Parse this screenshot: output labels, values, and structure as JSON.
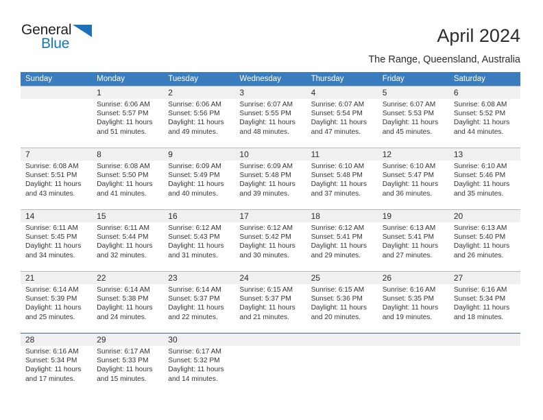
{
  "brand": {
    "name_top": "General",
    "name_bottom": "Blue",
    "color_top": "#231f20",
    "color_bottom": "#1277bc",
    "triangle_color": "#1f70b8"
  },
  "header": {
    "title": "April 2024",
    "subtitle": "The Range, Queensland, Australia"
  },
  "theme": {
    "header_bg": "#3a7dbf",
    "header_text": "#ffffff",
    "daynum_band": "#f0f0f0",
    "row_separator": "#b8b8b8",
    "last_row_separator": "#2e6da4"
  },
  "weekdays": [
    "Sunday",
    "Monday",
    "Tuesday",
    "Wednesday",
    "Thursday",
    "Friday",
    "Saturday"
  ],
  "weeks": [
    [
      {
        "day": "",
        "sunrise": "",
        "sunset": "",
        "daylight": ""
      },
      {
        "day": "1",
        "sunrise": "Sunrise: 6:06 AM",
        "sunset": "Sunset: 5:57 PM",
        "daylight": "Daylight: 11 hours and 51 minutes."
      },
      {
        "day": "2",
        "sunrise": "Sunrise: 6:06 AM",
        "sunset": "Sunset: 5:56 PM",
        "daylight": "Daylight: 11 hours and 49 minutes."
      },
      {
        "day": "3",
        "sunrise": "Sunrise: 6:07 AM",
        "sunset": "Sunset: 5:55 PM",
        "daylight": "Daylight: 11 hours and 48 minutes."
      },
      {
        "day": "4",
        "sunrise": "Sunrise: 6:07 AM",
        "sunset": "Sunset: 5:54 PM",
        "daylight": "Daylight: 11 hours and 47 minutes."
      },
      {
        "day": "5",
        "sunrise": "Sunrise: 6:07 AM",
        "sunset": "Sunset: 5:53 PM",
        "daylight": "Daylight: 11 hours and 45 minutes."
      },
      {
        "day": "6",
        "sunrise": "Sunrise: 6:08 AM",
        "sunset": "Sunset: 5:52 PM",
        "daylight": "Daylight: 11 hours and 44 minutes."
      }
    ],
    [
      {
        "day": "7",
        "sunrise": "Sunrise: 6:08 AM",
        "sunset": "Sunset: 5:51 PM",
        "daylight": "Daylight: 11 hours and 43 minutes."
      },
      {
        "day": "8",
        "sunrise": "Sunrise: 6:08 AM",
        "sunset": "Sunset: 5:50 PM",
        "daylight": "Daylight: 11 hours and 41 minutes."
      },
      {
        "day": "9",
        "sunrise": "Sunrise: 6:09 AM",
        "sunset": "Sunset: 5:49 PM",
        "daylight": "Daylight: 11 hours and 40 minutes."
      },
      {
        "day": "10",
        "sunrise": "Sunrise: 6:09 AM",
        "sunset": "Sunset: 5:48 PM",
        "daylight": "Daylight: 11 hours and 39 minutes."
      },
      {
        "day": "11",
        "sunrise": "Sunrise: 6:10 AM",
        "sunset": "Sunset: 5:48 PM",
        "daylight": "Daylight: 11 hours and 37 minutes."
      },
      {
        "day": "12",
        "sunrise": "Sunrise: 6:10 AM",
        "sunset": "Sunset: 5:47 PM",
        "daylight": "Daylight: 11 hours and 36 minutes."
      },
      {
        "day": "13",
        "sunrise": "Sunrise: 6:10 AM",
        "sunset": "Sunset: 5:46 PM",
        "daylight": "Daylight: 11 hours and 35 minutes."
      }
    ],
    [
      {
        "day": "14",
        "sunrise": "Sunrise: 6:11 AM",
        "sunset": "Sunset: 5:45 PM",
        "daylight": "Daylight: 11 hours and 34 minutes."
      },
      {
        "day": "15",
        "sunrise": "Sunrise: 6:11 AM",
        "sunset": "Sunset: 5:44 PM",
        "daylight": "Daylight: 11 hours and 32 minutes."
      },
      {
        "day": "16",
        "sunrise": "Sunrise: 6:12 AM",
        "sunset": "Sunset: 5:43 PM",
        "daylight": "Daylight: 11 hours and 31 minutes."
      },
      {
        "day": "17",
        "sunrise": "Sunrise: 6:12 AM",
        "sunset": "Sunset: 5:42 PM",
        "daylight": "Daylight: 11 hours and 30 minutes."
      },
      {
        "day": "18",
        "sunrise": "Sunrise: 6:12 AM",
        "sunset": "Sunset: 5:41 PM",
        "daylight": "Daylight: 11 hours and 29 minutes."
      },
      {
        "day": "19",
        "sunrise": "Sunrise: 6:13 AM",
        "sunset": "Sunset: 5:41 PM",
        "daylight": "Daylight: 11 hours and 27 minutes."
      },
      {
        "day": "20",
        "sunrise": "Sunrise: 6:13 AM",
        "sunset": "Sunset: 5:40 PM",
        "daylight": "Daylight: 11 hours and 26 minutes."
      }
    ],
    [
      {
        "day": "21",
        "sunrise": "Sunrise: 6:14 AM",
        "sunset": "Sunset: 5:39 PM",
        "daylight": "Daylight: 11 hours and 25 minutes."
      },
      {
        "day": "22",
        "sunrise": "Sunrise: 6:14 AM",
        "sunset": "Sunset: 5:38 PM",
        "daylight": "Daylight: 11 hours and 24 minutes."
      },
      {
        "day": "23",
        "sunrise": "Sunrise: 6:14 AM",
        "sunset": "Sunset: 5:37 PM",
        "daylight": "Daylight: 11 hours and 22 minutes."
      },
      {
        "day": "24",
        "sunrise": "Sunrise: 6:15 AM",
        "sunset": "Sunset: 5:37 PM",
        "daylight": "Daylight: 11 hours and 21 minutes."
      },
      {
        "day": "25",
        "sunrise": "Sunrise: 6:15 AM",
        "sunset": "Sunset: 5:36 PM",
        "daylight": "Daylight: 11 hours and 20 minutes."
      },
      {
        "day": "26",
        "sunrise": "Sunrise: 6:16 AM",
        "sunset": "Sunset: 5:35 PM",
        "daylight": "Daylight: 11 hours and 19 minutes."
      },
      {
        "day": "27",
        "sunrise": "Sunrise: 6:16 AM",
        "sunset": "Sunset: 5:34 PM",
        "daylight": "Daylight: 11 hours and 18 minutes."
      }
    ],
    [
      {
        "day": "28",
        "sunrise": "Sunrise: 6:16 AM",
        "sunset": "Sunset: 5:34 PM",
        "daylight": "Daylight: 11 hours and 17 minutes."
      },
      {
        "day": "29",
        "sunrise": "Sunrise: 6:17 AM",
        "sunset": "Sunset: 5:33 PM",
        "daylight": "Daylight: 11 hours and 15 minutes."
      },
      {
        "day": "30",
        "sunrise": "Sunrise: 6:17 AM",
        "sunset": "Sunset: 5:32 PM",
        "daylight": "Daylight: 11 hours and 14 minutes."
      },
      {
        "day": "",
        "sunrise": "",
        "sunset": "",
        "daylight": ""
      },
      {
        "day": "",
        "sunrise": "",
        "sunset": "",
        "daylight": ""
      },
      {
        "day": "",
        "sunrise": "",
        "sunset": "",
        "daylight": ""
      },
      {
        "day": "",
        "sunrise": "",
        "sunset": "",
        "daylight": ""
      }
    ]
  ]
}
